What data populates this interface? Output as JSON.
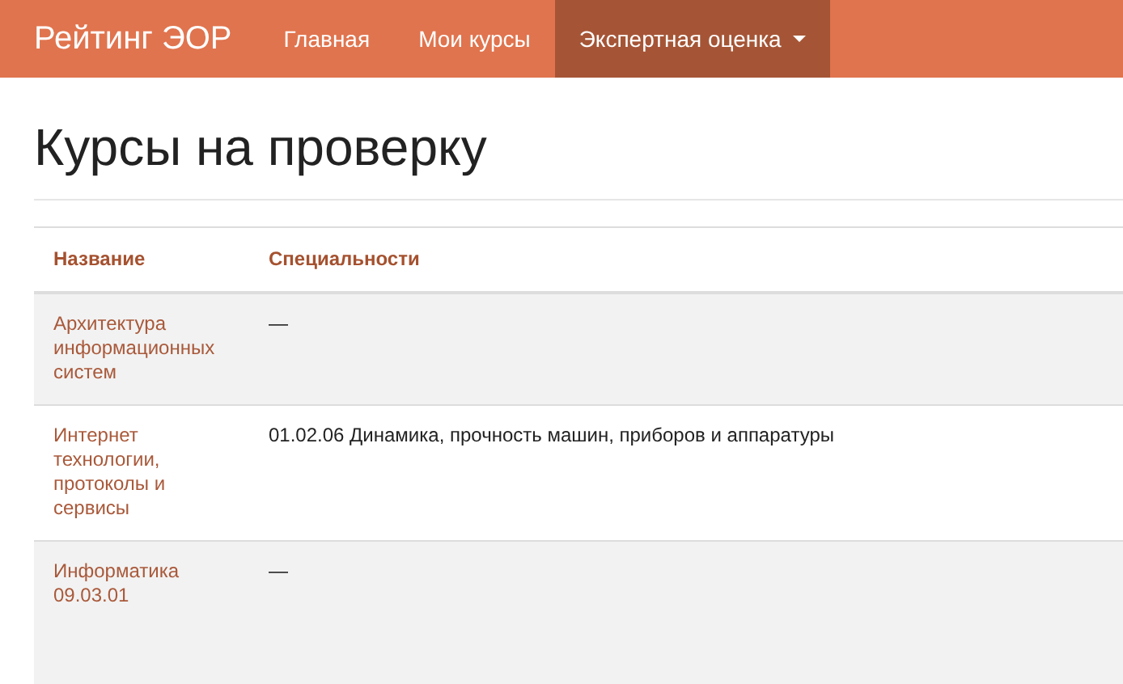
{
  "navbar": {
    "brand": "Рейтинг ЭОР",
    "items": [
      {
        "label": "Главная",
        "selected": false,
        "dropdown": false
      },
      {
        "label": "Мои курсы",
        "selected": false,
        "dropdown": false
      },
      {
        "label": "Экспертная оценка",
        "selected": true,
        "dropdown": true
      }
    ]
  },
  "page_title": "Курсы на проверку",
  "table": {
    "columns": [
      "Название",
      "Специальности"
    ],
    "rows": [
      {
        "name": "Архитектура информационных систем",
        "specialties": "—"
      },
      {
        "name": "Интернет технологии, протоколы и сервисы",
        "specialties": "01.02.06 Динамика, прочность машин, приборов и аппаратуры"
      },
      {
        "name": "Информатика 09.03.01",
        "specialties": "—"
      }
    ]
  }
}
